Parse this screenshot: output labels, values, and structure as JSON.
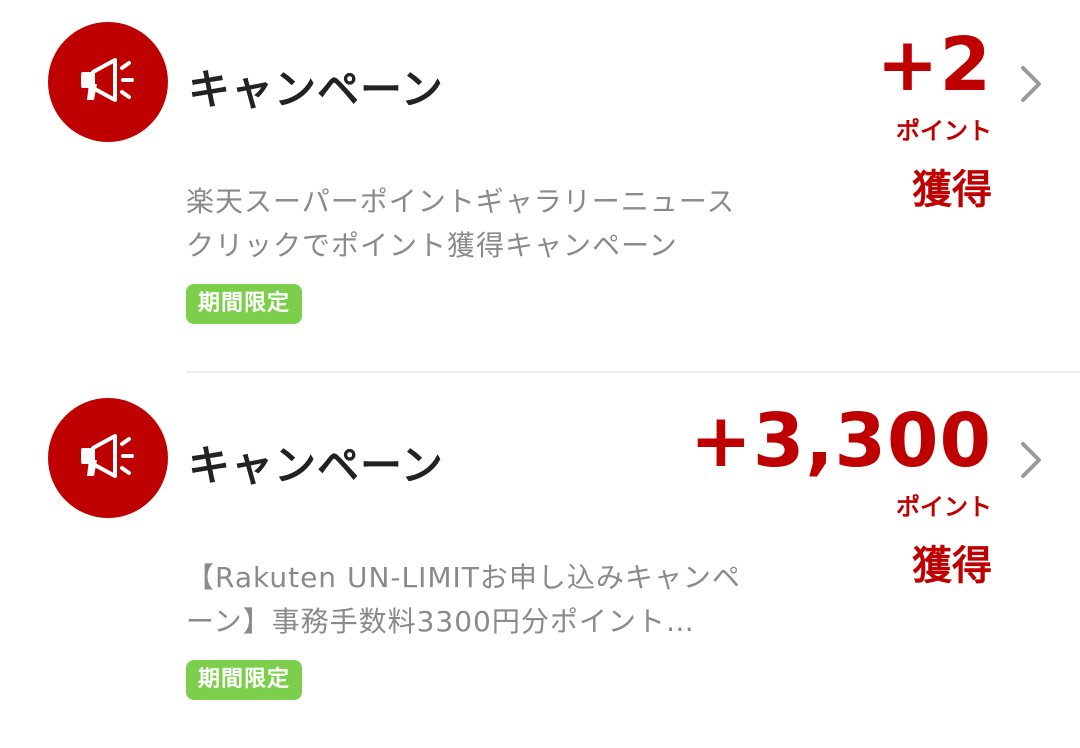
{
  "items": [
    {
      "category": "キャンペーン",
      "icon": "megaphone-icon",
      "points_value": "+2",
      "points_unit": "ポイント",
      "points_earned": "獲得",
      "description": "楽天スーパーポイントギャラリーニュースクリックでポイント獲得キャンペーン",
      "badge": "期間限定"
    },
    {
      "category": "キャンペーン",
      "icon": "megaphone-icon",
      "points_value": "+3,300",
      "points_unit": "ポイント",
      "points_earned": "獲得",
      "description": "【Rakuten UN-LIMITお申し込みキャンペーン】事務手数料3300円分ポイント…",
      "badge": "期間限定"
    }
  ],
  "colors": {
    "brand_red": "#bf0000",
    "badge_green": "#7ccf4b",
    "text_primary": "#222222",
    "text_secondary": "#8a8a8a",
    "chevron_gray": "#9a9a9a"
  }
}
